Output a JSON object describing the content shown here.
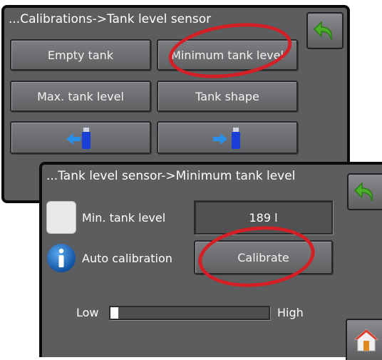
{
  "back_panel": {
    "title": "...Calibrations->Tank level sensor",
    "buttons": {
      "empty_tank": "Empty tank",
      "minimum_tank_level": "Minimum tank level",
      "max_tank_level": "Max. tank level",
      "tank_shape": "Tank shape"
    },
    "icons": [
      "usb-export-icon",
      "usb-import-icon",
      "return-arrow-icon"
    ]
  },
  "front_panel": {
    "title": "...Tank level sensor->Minimum tank level",
    "min_tank_level_label": "Min. tank level",
    "min_tank_level_value": "189 l",
    "auto_calibration_label": "Auto calibration",
    "calibrate_button": "Calibrate",
    "slider_low_label": "Low",
    "slider_high_label": "High",
    "slider_level": 0.05,
    "icons": [
      "return-arrow-icon",
      "info-icon",
      "home-icon"
    ]
  },
  "colors": {
    "panel_bg": "#5b5d5f",
    "highlight_ring": "#d31f26",
    "arrow_green": "#4caf2a",
    "info_blue": "#1a6fc4",
    "usb_blue": "#1a3fd6"
  }
}
